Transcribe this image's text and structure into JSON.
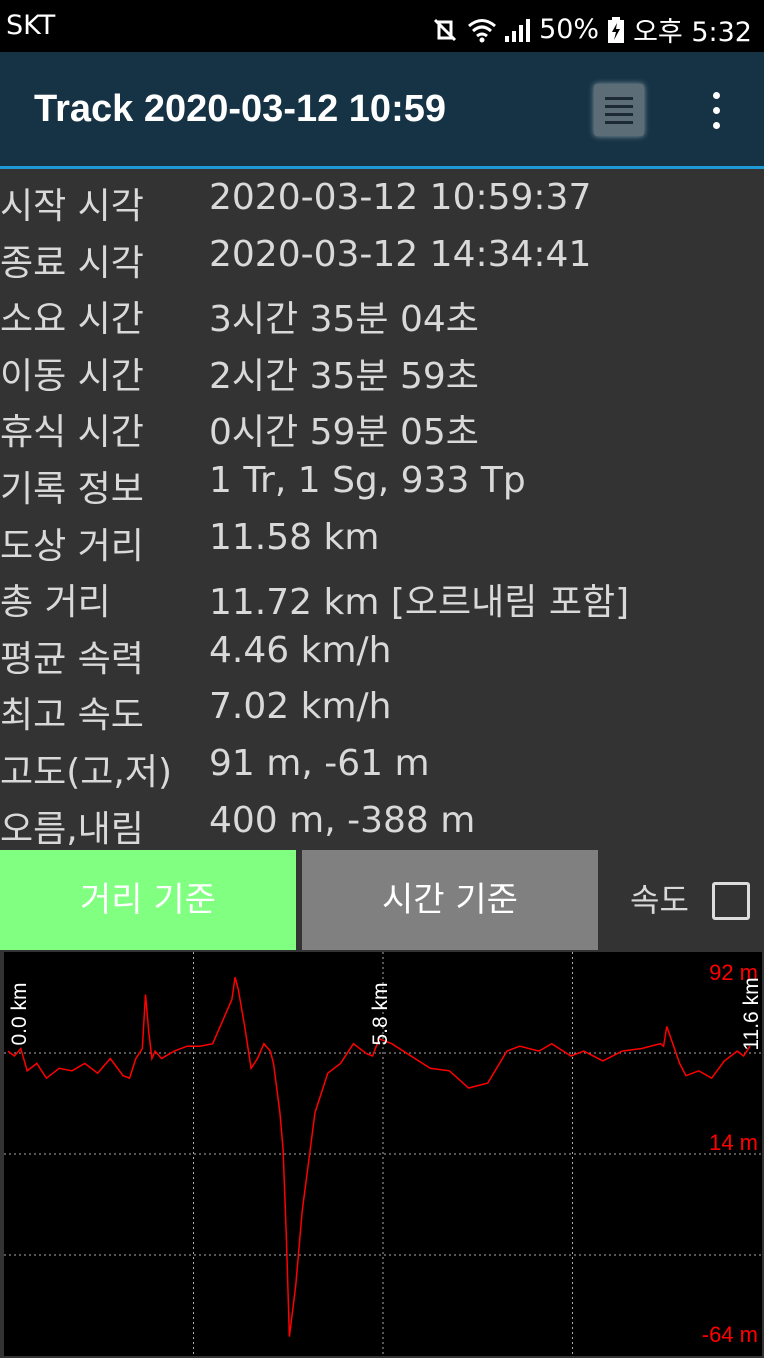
{
  "status_bar": {
    "carrier": "SKT",
    "battery": "50%",
    "time": "오후 5:32",
    "icons": [
      "mute-vibrate-icon",
      "wifi-icon",
      "signal-icon",
      "battery-icon"
    ]
  },
  "app_bar": {
    "title": "Track 2020-03-12 10:59",
    "icons": [
      "list-icon",
      "more-vert-icon"
    ]
  },
  "stats": [
    {
      "label": "시작 시각",
      "value": "2020-03-12 10:59:37"
    },
    {
      "label": "종료 시각",
      "value": "2020-03-12 14:34:41"
    },
    {
      "label": "소요 시간",
      "value": "3시간 35분 04초"
    },
    {
      "label": "이동 시간",
      "value": "2시간 35분 59초"
    },
    {
      "label": "휴식 시간",
      "value": "0시간 59분 05초"
    },
    {
      "label": "기록 정보",
      "value": "1 Tr, 1 Sg, 933 Tp"
    },
    {
      "label": "도상 거리",
      "value": "11.58 km"
    },
    {
      "label": "총 거리",
      "value": "11.72 km [오르내림 포함]"
    },
    {
      "label": "평균 속력",
      "value": "4.46 km/h"
    },
    {
      "label": "최고 속도",
      "value": "7.02 km/h"
    },
    {
      "label": "고도(고,저)",
      "value": "91 m, -61 m"
    },
    {
      "label": "오름,내림",
      "value": "400 m, -388 m"
    }
  ],
  "tabs": {
    "distance_label": "거리 기준",
    "time_label": "시간 기준",
    "speed_label": "속도",
    "speed_checked": false,
    "active": "distance",
    "active_color": "#80ff80",
    "inactive_color": "#808080"
  },
  "chart_data": {
    "type": "line",
    "line_color": "#ff0000",
    "grid": true,
    "xlim": [
      0,
      11.6
    ],
    "ylim": [
      -64,
      92
    ],
    "x_tick_labels": [
      "0.0 km",
      "5.8 km",
      "11.6 km"
    ],
    "x_ticks": [
      0,
      5.8,
      11.6
    ],
    "y_tick_labels": [
      "92 m",
      "14 m",
      "-64 m"
    ],
    "y_ticks": [
      92,
      14,
      -64
    ],
    "series": [
      {
        "x": [
          0,
          0.1,
          0.2,
          0.3,
          0.45,
          0.6,
          0.8,
          1.0,
          1.2,
          1.4,
          1.6,
          1.8,
          1.9,
          2.0,
          2.1,
          2.15,
          2.2,
          2.25,
          2.3,
          2.4,
          2.6,
          2.8,
          3.0,
          3.2,
          3.4,
          3.5,
          3.55,
          3.6,
          3.7,
          3.8,
          3.9,
          4.0,
          4.1,
          4.15,
          4.2,
          4.25,
          4.3,
          4.35,
          4.4,
          4.5,
          4.6,
          4.8,
          5.0,
          5.2,
          5.4,
          5.6,
          5.7,
          5.8,
          5.9,
          6.0,
          6.3,
          6.6,
          6.9,
          7.2,
          7.5,
          7.8,
          8.0,
          8.3,
          8.5,
          8.8,
          9.0,
          9.3,
          9.6,
          9.9,
          10.2,
          10.25,
          10.3,
          10.5,
          10.6,
          10.8,
          11.0,
          11.2,
          11.4,
          11.5,
          11.6
        ],
        "y": [
          55,
          53,
          56,
          47,
          50,
          44,
          48,
          47,
          50,
          46,
          52,
          45,
          44,
          52,
          56,
          78,
          63,
          52,
          55,
          52,
          55,
          57,
          57,
          58,
          70,
          76,
          85,
          80,
          65,
          48,
          52,
          58,
          55,
          50,
          40,
          30,
          15,
          -20,
          -61,
          -40,
          -10,
          30,
          46,
          50,
          58,
          54,
          53,
          60,
          59,
          58,
          53,
          48,
          47,
          40,
          42,
          55,
          57,
          55,
          58,
          53,
          55,
          51,
          55,
          56,
          58,
          57,
          65,
          50,
          45,
          47,
          44,
          51,
          55,
          53,
          57
        ]
      }
    ]
  }
}
